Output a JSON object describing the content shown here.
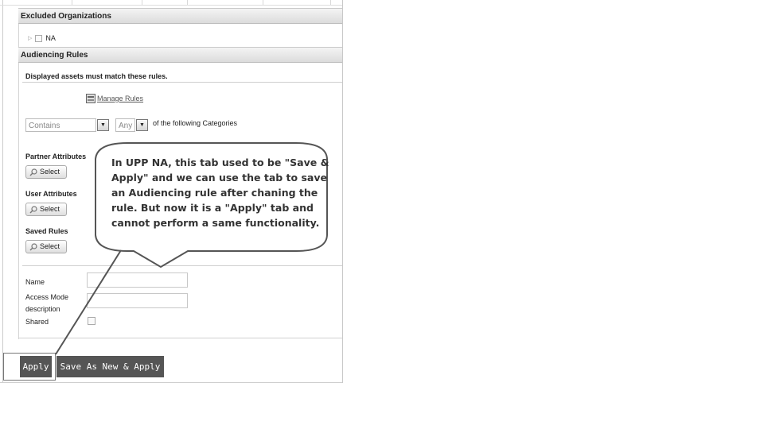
{
  "excluded_orgs": {
    "header": "Excluded Organizations",
    "items": [
      {
        "label": "NA"
      }
    ]
  },
  "audiencing": {
    "header": "Audiencing Rules",
    "intro": "Displayed assets must match these rules.",
    "manage_rules_link": "Manage Rules",
    "condition": {
      "value": "Contains",
      "quantifier": "Any",
      "suffix": "of the following Categories"
    },
    "groups": [
      {
        "label": "Partner Attributes",
        "button": "Select"
      },
      {
        "label": "User Attributes",
        "button": "Select"
      },
      {
        "label": "Saved Rules",
        "button": "Select"
      }
    ],
    "form": {
      "name_label": "Name",
      "name_value": "",
      "access_label_line1": "Access Mode",
      "access_label_line2": "description",
      "access_value": "",
      "shared_label": "Shared",
      "shared_checked": false
    }
  },
  "actions": {
    "apply": "Apply",
    "save_as_new": "Save As New & Apply"
  },
  "annotation": {
    "lines": [
      "In UPP NA, this tab used to be \"Save &",
      "Apply\" and we can use the tab to save",
      "an Audiencing rule after chaning the",
      "rule. But now it is a \"Apply\" tab and",
      "cannot perform a same functionality."
    ]
  },
  "icons": {
    "expand": "triangle-right-icon",
    "manage": "rules-icon",
    "dropdown": "chevron-down-icon",
    "select": "magnifier-icon"
  }
}
